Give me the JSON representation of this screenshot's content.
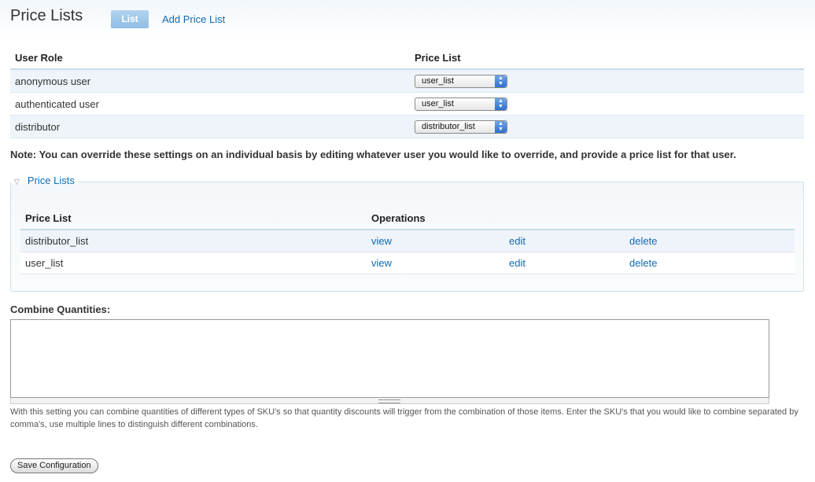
{
  "header": {
    "title": "Price Lists",
    "tabs": [
      {
        "label": "List",
        "active": true
      },
      {
        "label": "Add Price List",
        "active": false
      }
    ]
  },
  "roles_table": {
    "columns": [
      "User Role",
      "Price List"
    ],
    "rows": [
      {
        "role": "anonymous user",
        "price_list": "user_list"
      },
      {
        "role": "authenticated user",
        "price_list": "user_list"
      },
      {
        "role": "distributor",
        "price_list": "distributor_list"
      }
    ]
  },
  "note": "Note: You can override these settings on an individual basis by editing whatever user you would like to override, and provide a price list for that user.",
  "fieldset": {
    "legend": "Price Lists",
    "columns": [
      "Price List",
      "Operations"
    ],
    "rows": [
      {
        "name": "distributor_list",
        "view": "view",
        "edit": "edit",
        "delete": "delete"
      },
      {
        "name": "user_list",
        "view": "view",
        "edit": "edit",
        "delete": "delete"
      }
    ]
  },
  "combine": {
    "label": "Combine Quantities:",
    "value": "",
    "description": "With this setting you can combine quantities of different types of SKU's so that quantity discounts will trigger from the combination of those items. Enter the SKU's that you would like to combine separated by comma's, use multiple lines to distinguish different combinations."
  },
  "save_button": "Save Configuration",
  "colors": {
    "link": "#0e6bb3",
    "tab_active_bg": "#9fc8ea",
    "row_stripe": "#eef4fa"
  },
  "icons": {
    "collapse": "triangle-down-icon",
    "select": "select-arrows-icon",
    "resize": "grippie-icon"
  }
}
